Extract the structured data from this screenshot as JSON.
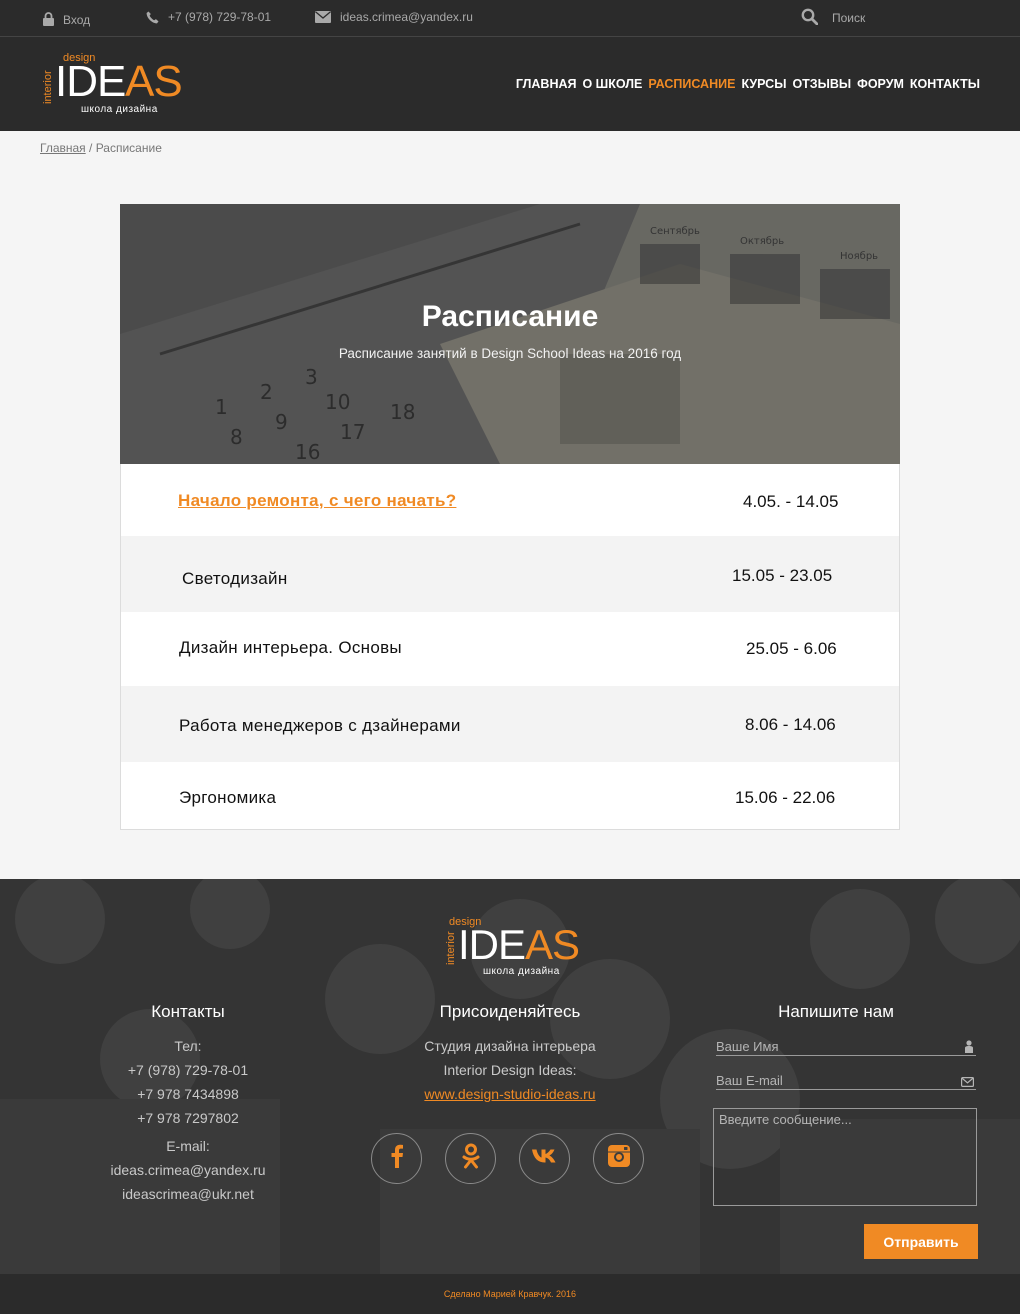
{
  "topbar": {
    "login_label": "Вход",
    "phone": "+7 (978) 729-78-01",
    "email": "ideas.crimea@yandex.ru",
    "search_label": "Поиск"
  },
  "logo": {
    "design": "design",
    "interior": "interior",
    "ide": "IDE",
    "as": "AS",
    "school": "школа дизайна"
  },
  "nav": {
    "items": [
      {
        "label": "ГЛАВНАЯ",
        "active": false
      },
      {
        "label": "О ШКОЛЕ",
        "active": false
      },
      {
        "label": "РАСПИСАНИЕ",
        "active": true
      },
      {
        "label": "КУРСЫ",
        "active": false
      },
      {
        "label": "ОТЗЫВЫ",
        "active": false
      },
      {
        "label": "ФОРУМ",
        "active": false
      },
      {
        "label": "КОНТАКТЫ",
        "active": false
      }
    ]
  },
  "breadcrumb": {
    "home": "Главная",
    "separator": " / ",
    "current": "Расписание"
  },
  "hero": {
    "title": "Расписание",
    "subtitle": "Расписание занятий в Design School Ideas на 2016 год"
  },
  "schedule": {
    "rows": [
      {
        "title": "Начало ремонта, с чего начать?",
        "date": "4.05. - 14.05",
        "link": true
      },
      {
        "title": "Светодизайн",
        "date": "15.05 - 23.05",
        "link": false
      },
      {
        "title": "Дизайн интерьера. Основы",
        "date": "25.05 - 6.06",
        "link": false
      },
      {
        "title": "Работа менеджеров с дзайнерами",
        "date": "8.06 - 14.06",
        "link": false
      },
      {
        "title": "Эргономика",
        "date": "15.06 - 22.06",
        "link": false
      }
    ]
  },
  "footer": {
    "contacts": {
      "heading": "Контакты",
      "tel_label": "Тел:",
      "phones": [
        "+7 (978) 729-78-01",
        "+7 978 7434898",
        "+7 978 7297802"
      ],
      "email_label": "E-mail:",
      "emails": [
        "ideas.crimea@yandex.ru",
        "ideascrimea@ukr.net"
      ]
    },
    "join": {
      "heading": "Присоиденяйтесь",
      "line1": "Студия дизайна інтерьера",
      "line2": "Interior Design Ideas:",
      "link": "www.design-studio-ideas.ru",
      "social_icons": [
        "facebook-icon",
        "odnoklassniki-icon",
        "vk-icon",
        "instagram-icon"
      ]
    },
    "write": {
      "heading": "Напишите нам",
      "name_placeholder": "Ваше Имя",
      "email_placeholder": "Ваш E-mail",
      "message_placeholder": "Введите сообщение...",
      "send_label": "Отправить"
    },
    "credit": "Сделано Марией Кравчук. 2016"
  },
  "colors": {
    "accent": "#f08a24",
    "dark": "#2b2b2b"
  }
}
